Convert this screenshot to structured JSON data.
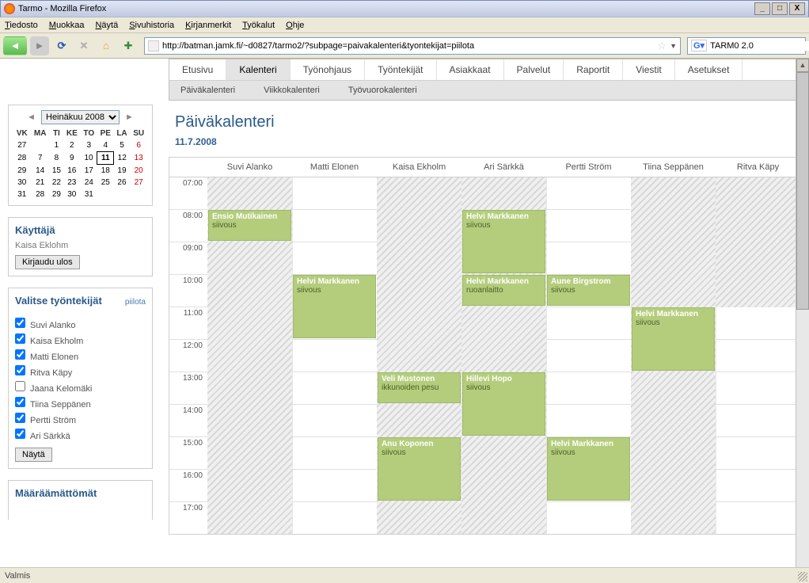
{
  "window": {
    "title": "Tarmo - Mozilla Firefox"
  },
  "menubar": [
    "Tiedosto",
    "Muokkaa",
    "Näytä",
    "Sivuhistoria",
    "Kirjanmerkit",
    "Työkalut",
    "Ohje"
  ],
  "url": "http://batman.jamk.fi/~d0827/tarmo2/?subpage=paivakalenteri&tyontekijat=piilota",
  "search": "TARM0 2.0",
  "statusbar": "Valmis",
  "minical": {
    "month_label": "Heinäkuu 2008",
    "dow": [
      "VK",
      "MA",
      "TI",
      "KE",
      "TO",
      "PE",
      "LA",
      "SU"
    ],
    "weeks": [
      [
        "27",
        "",
        "1",
        "2",
        "3",
        "4",
        "5",
        "6"
      ],
      [
        "28",
        "7",
        "8",
        "9",
        "10",
        "11",
        "12",
        "13"
      ],
      [
        "29",
        "14",
        "15",
        "16",
        "17",
        "18",
        "19",
        "20"
      ],
      [
        "30",
        "21",
        "22",
        "23",
        "24",
        "25",
        "26",
        "27"
      ],
      [
        "31",
        "28",
        "29",
        "30",
        "31",
        "",
        "",
        ""
      ]
    ],
    "today": "11"
  },
  "user_panel": {
    "title": "Käyttäjä",
    "name": "Kaisa Eklohm",
    "logout": "Kirjaudu ulos"
  },
  "emp_panel": {
    "title": "Valitse työntekijät",
    "hide": "piilota",
    "show_btn": "Näytä",
    "employees": [
      {
        "name": "Suvi Alanko",
        "checked": true
      },
      {
        "name": "Kaisa Ekholm",
        "checked": true
      },
      {
        "name": "Matti Elonen",
        "checked": true
      },
      {
        "name": "Ritva Käpy",
        "checked": true
      },
      {
        "name": "Jaana Kelomäki",
        "checked": false
      },
      {
        "name": "Tiina Seppänen",
        "checked": true
      },
      {
        "name": "Pertti Ström",
        "checked": true
      },
      {
        "name": "Ari Särkkä",
        "checked": true
      }
    ]
  },
  "unassigned_title": "Määräämättömät",
  "tabs": [
    "Etusivu",
    "Kalenteri",
    "Työnohjaus",
    "Työntekijät",
    "Asiakkaat",
    "Palvelut",
    "Raportit",
    "Viestit",
    "Asetukset"
  ],
  "active_tab": "Kalenteri",
  "subtabs": [
    "Päiväkalenteri",
    "Viikkokalenteri",
    "Työvuorokalenteri"
  ],
  "page": {
    "title": "Päiväkalenteri",
    "date": "11.7.2008"
  },
  "columns": [
    "Suvi Alanko",
    "Matti Elonen",
    "Kaisa Ekholm",
    "Ari Särkkä",
    "Pertti Ström",
    "Tiina Seppänen",
    "Ritva Käpy"
  ],
  "hours": [
    "07:00",
    "08:00",
    "09:00",
    "10:00",
    "11:00",
    "12:00",
    "13:00",
    "14:00",
    "15:00",
    "16:00",
    "17:00"
  ],
  "hatching": [
    {
      "col": 0,
      "start": "07:00",
      "end": "18:00"
    },
    {
      "col": 2,
      "start": "07:00",
      "end": "18:00"
    },
    {
      "col": 3,
      "start": "07:00",
      "end": "18:00"
    },
    {
      "col": 5,
      "start": "07:00",
      "end": "18:00"
    },
    {
      "col": 6,
      "start": "07:00",
      "end": "11:00"
    }
  ],
  "events": [
    {
      "col": 0,
      "name": "Ensio Mutikainen",
      "task": "siivous",
      "start": "08:00",
      "end": "09:00"
    },
    {
      "col": 1,
      "name": "Helvi Markkanen",
      "task": "siivous",
      "start": "10:00",
      "end": "12:00"
    },
    {
      "col": 2,
      "name": "Veli Mustonen",
      "task": "ikkunoiden pesu",
      "start": "13:00",
      "end": "14:00"
    },
    {
      "col": 2,
      "name": "Anu Koponen",
      "task": "siivous",
      "start": "15:00",
      "end": "17:00"
    },
    {
      "col": 3,
      "name": "Helvi Markkanen",
      "task": "siivous",
      "start": "08:00",
      "end": "10:00"
    },
    {
      "col": 3,
      "name": "Helvi Markkanen",
      "task": "ruoanlaitto",
      "start": "10:00",
      "end": "11:00"
    },
    {
      "col": 3,
      "name": "Hillevi Hopo",
      "task": "siivous",
      "start": "13:00",
      "end": "15:00"
    },
    {
      "col": 4,
      "name": "Aune Birgstrom",
      "task": "siivous",
      "start": "10:00",
      "end": "11:00"
    },
    {
      "col": 4,
      "name": "Helvi Markkanen",
      "task": "siivous",
      "start": "15:00",
      "end": "17:00"
    },
    {
      "col": 5,
      "name": "Helvi Markkanen",
      "task": "siivous",
      "start": "11:00",
      "end": "13:00"
    }
  ]
}
